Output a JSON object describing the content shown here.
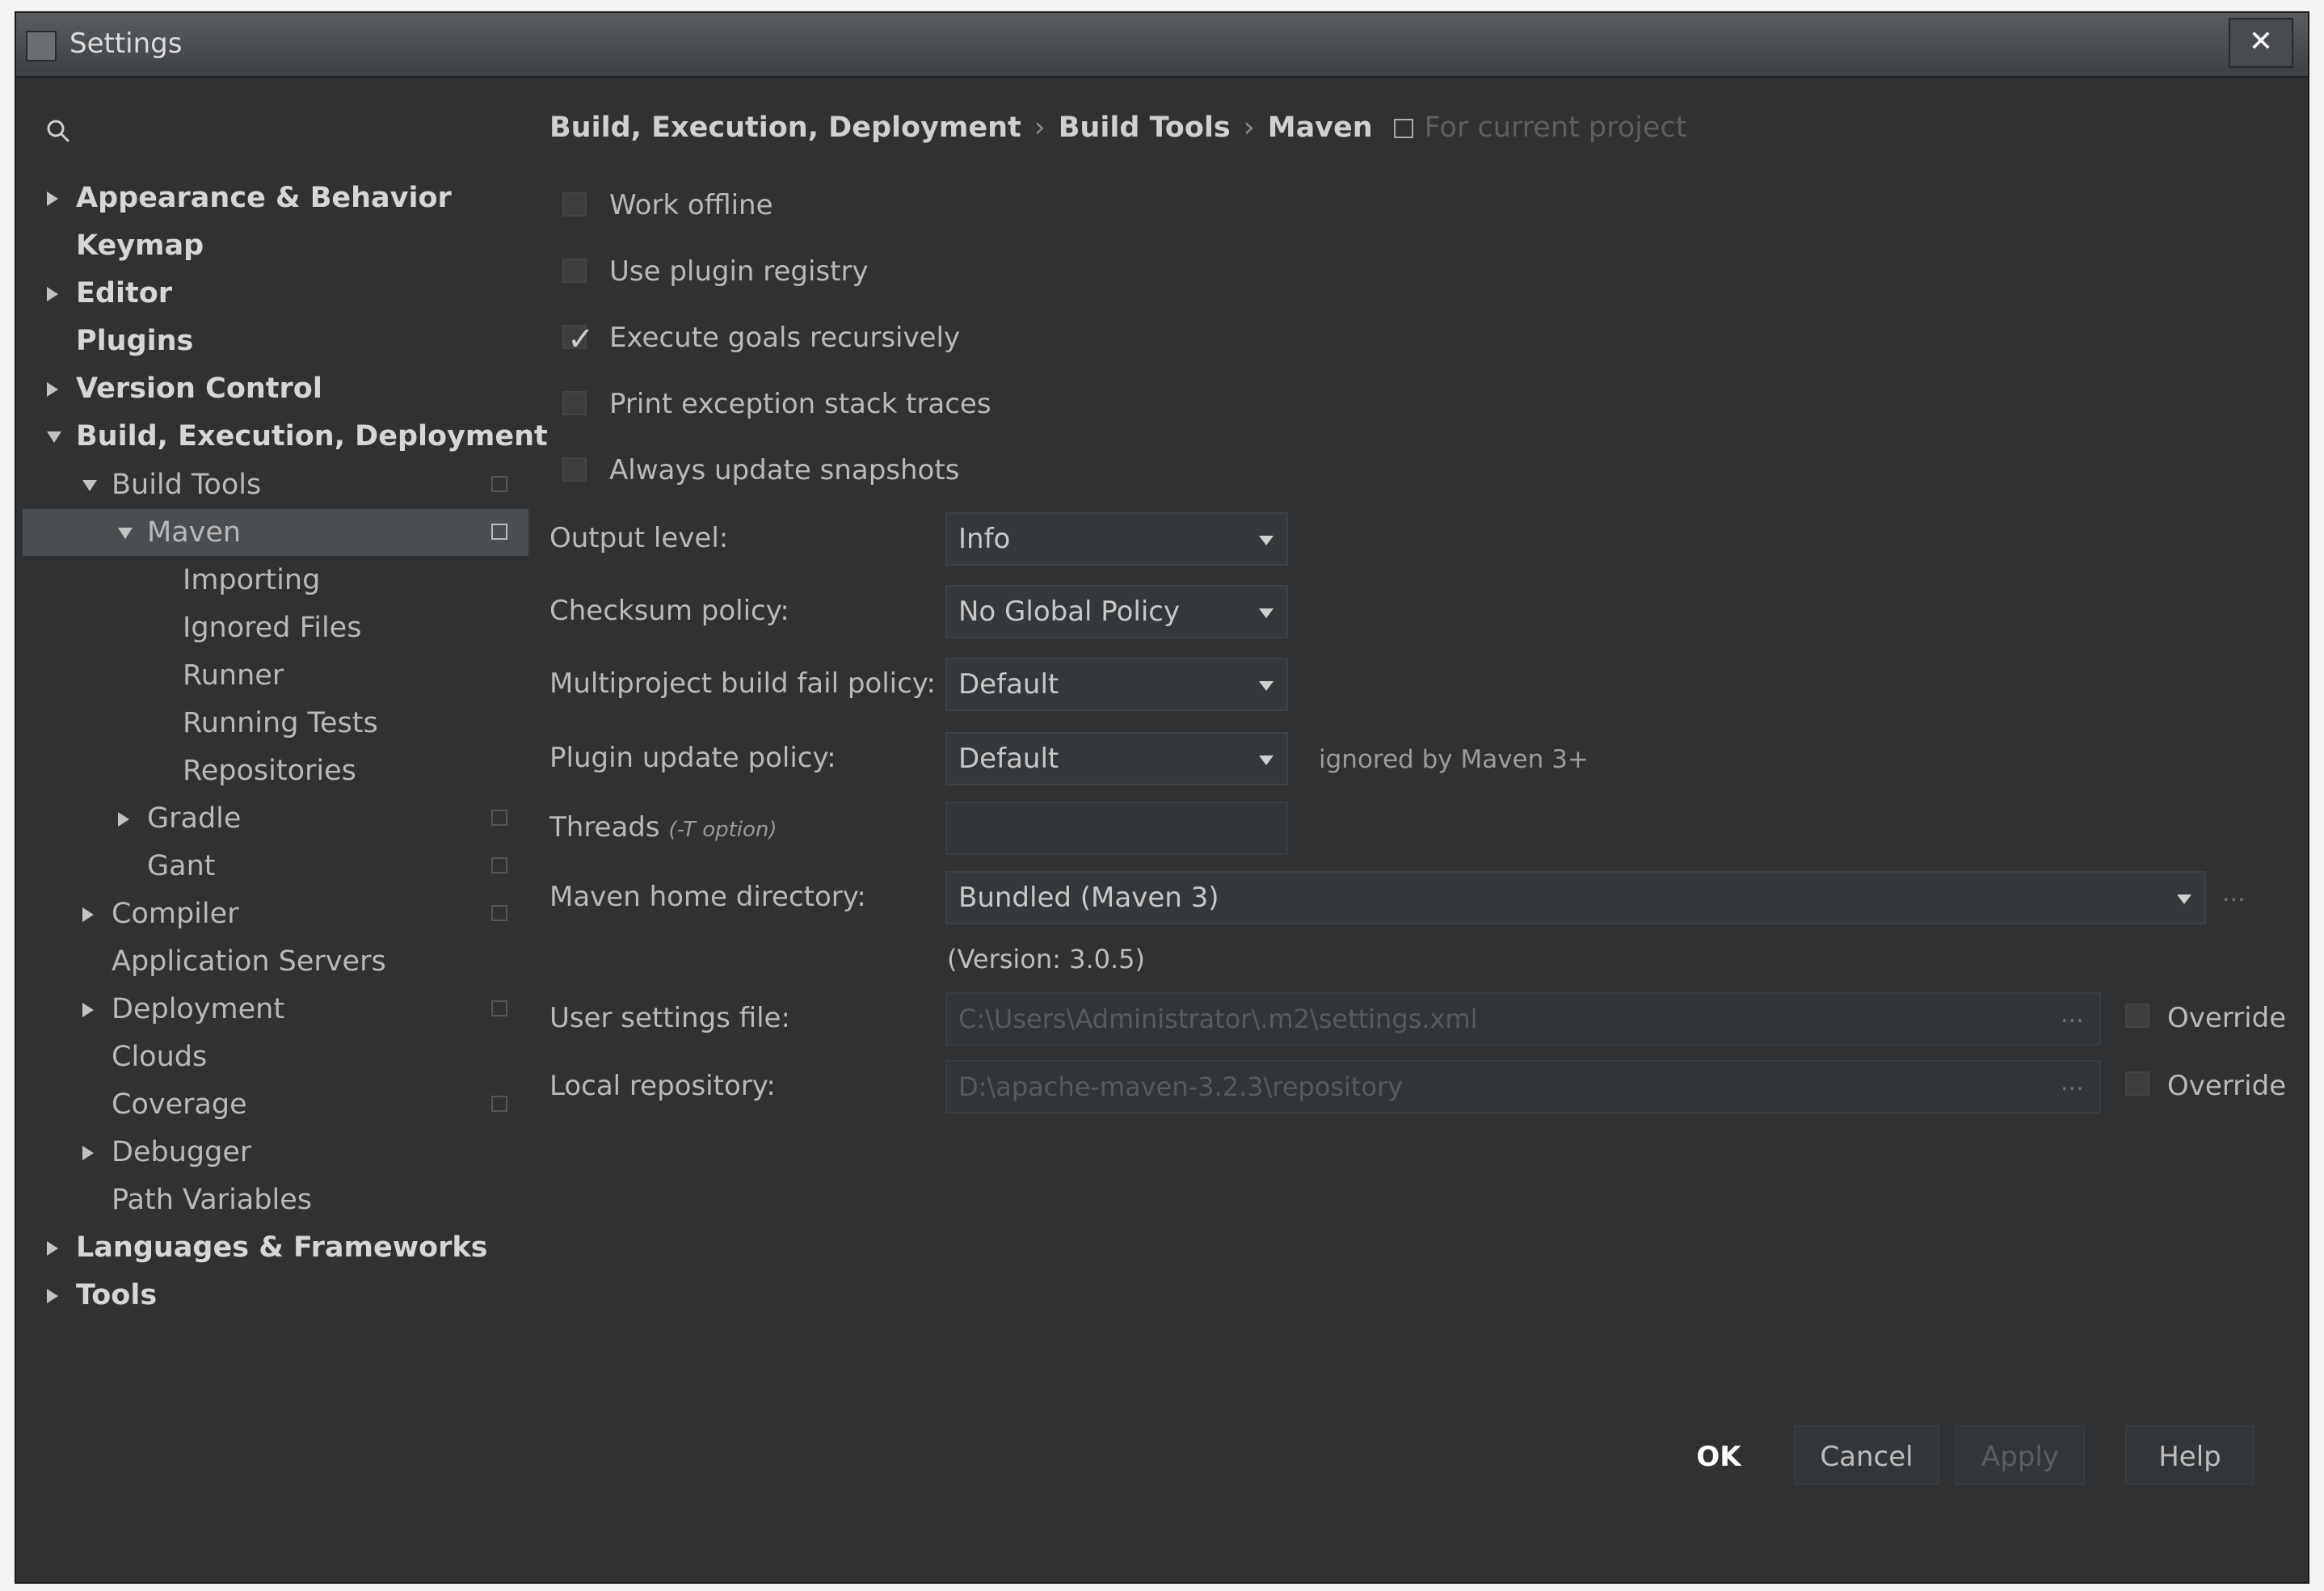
{
  "window": {
    "title": "Settings"
  },
  "sidebar": {
    "items": [
      {
        "label": "Appearance & Behavior",
        "expander": "right"
      },
      {
        "label": "Keymap",
        "expander": "none"
      },
      {
        "label": "Editor",
        "expander": "right"
      },
      {
        "label": "Plugins",
        "expander": "none"
      },
      {
        "label": "Version Control",
        "expander": "right"
      },
      {
        "label": "Build, Execution, Deployment",
        "expander": "down"
      },
      {
        "label": "Build Tools",
        "expander": "down"
      },
      {
        "label": "Maven",
        "expander": "down",
        "selected": true
      },
      {
        "label": "Importing",
        "expander": "none"
      },
      {
        "label": "Ignored Files",
        "expander": "none"
      },
      {
        "label": "Runner",
        "expander": "none"
      },
      {
        "label": "Running Tests",
        "expander": "none"
      },
      {
        "label": "Repositories",
        "expander": "none"
      },
      {
        "label": "Gradle",
        "expander": "right"
      },
      {
        "label": "Gant",
        "expander": "none"
      },
      {
        "label": "Compiler",
        "expander": "right"
      },
      {
        "label": "Application Servers",
        "expander": "none"
      },
      {
        "label": "Deployment",
        "expander": "right"
      },
      {
        "label": "Clouds",
        "expander": "none"
      },
      {
        "label": "Coverage",
        "expander": "none"
      },
      {
        "label": "Debugger",
        "expander": "right"
      },
      {
        "label": "Path Variables",
        "expander": "none"
      },
      {
        "label": "Languages & Frameworks",
        "expander": "right"
      },
      {
        "label": "Tools",
        "expander": "right"
      }
    ]
  },
  "breadcrumb": {
    "parts": [
      "Build, Execution, Deployment",
      "Build Tools",
      "Maven"
    ],
    "separator": "›",
    "note": "For current project"
  },
  "options": {
    "checkboxes": [
      {
        "label": "Work offline",
        "checked": false
      },
      {
        "label": "Use plugin registry",
        "checked": false
      },
      {
        "label": "Execute goals recursively",
        "checked": true
      },
      {
        "label": "Print exception stack traces",
        "checked": false
      },
      {
        "label": "Always update snapshots",
        "checked": false
      }
    ],
    "output_level": {
      "label": "Output level:",
      "value": "Info"
    },
    "checksum_policy": {
      "label": "Checksum policy:",
      "value": "No Global Policy"
    },
    "fail_policy": {
      "label": "Multiproject build fail policy:",
      "value": "Default"
    },
    "plugin_update_policy": {
      "label": "Plugin update policy:",
      "value": "Default",
      "note": "ignored by Maven 3+"
    },
    "threads": {
      "label": "Threads",
      "hint": "(-T option)",
      "value": ""
    },
    "maven_home": {
      "label": "Maven home directory:",
      "value": "Bundled (Maven 3)",
      "version": "(Version: 3.0.5)",
      "browse": "..."
    },
    "user_settings": {
      "label": "User settings file:",
      "value": "C:\\Users\\Administrator\\.m2\\settings.xml",
      "browse": "...",
      "override_label": "Override"
    },
    "local_repository": {
      "label": "Local repository:",
      "value": "D:\\apache-maven-3.2.3\\repository",
      "browse": "...",
      "override_label": "Override"
    }
  },
  "buttons": {
    "ok": "OK",
    "cancel": "Cancel",
    "apply": "Apply",
    "help": "Help"
  }
}
